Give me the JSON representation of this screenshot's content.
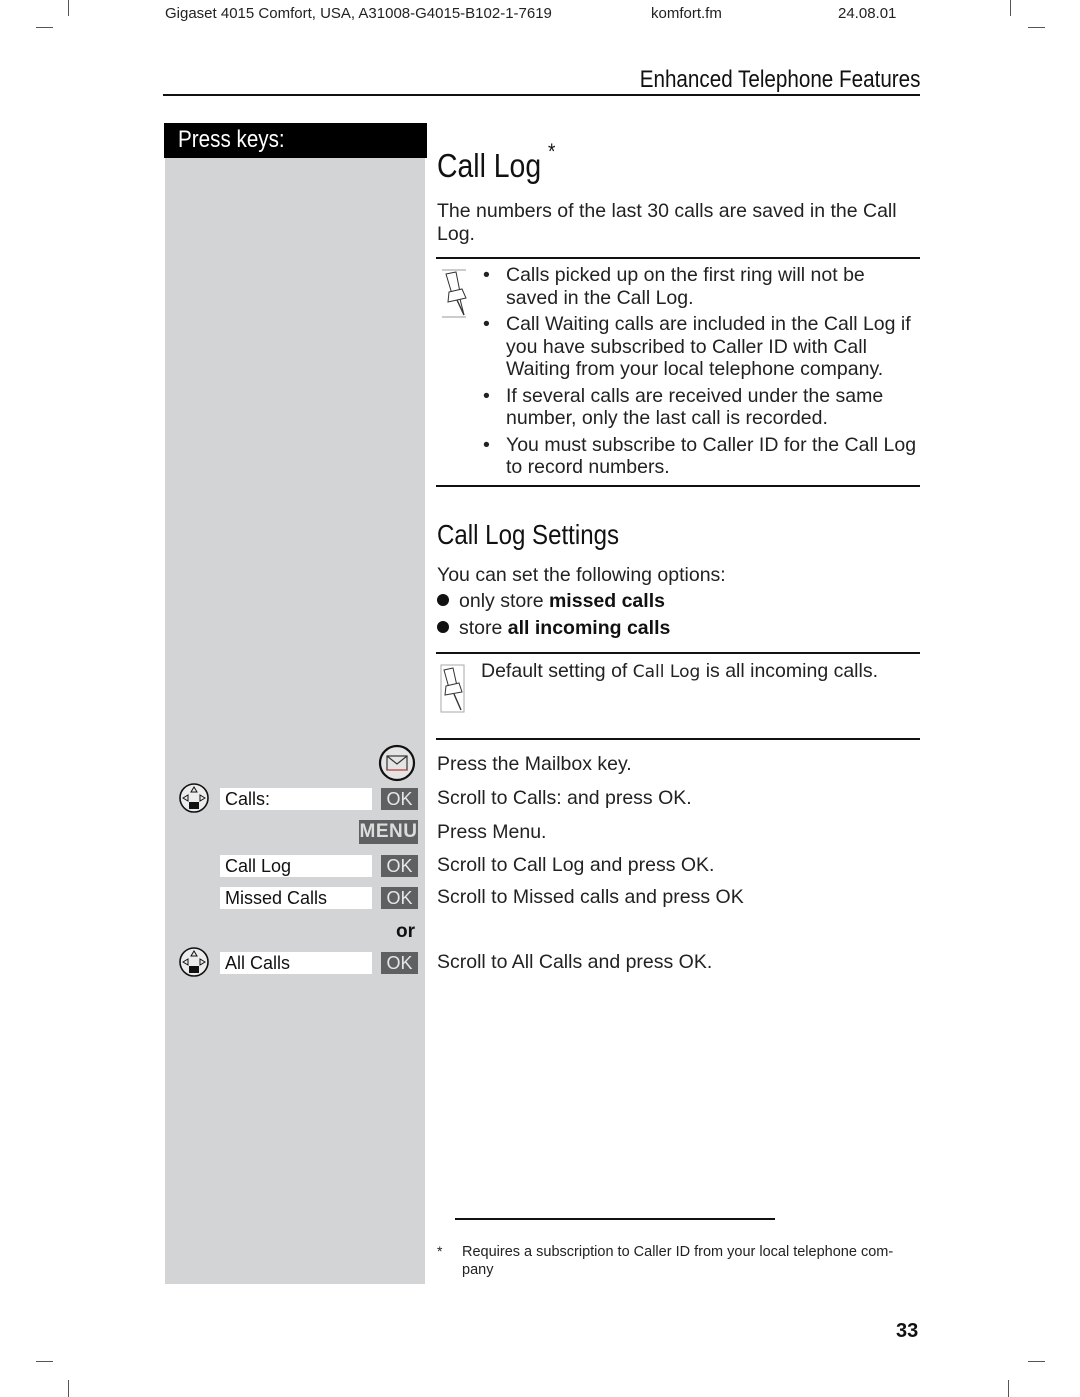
{
  "header": {
    "doc_id": "Gigaset 4015 Comfort, USA, A31008-G4015-B102-1-7619",
    "file": "komfort.fm",
    "date": "24.08.01"
  },
  "section_title": "Enhanced Telephone Features",
  "sidebar": {
    "title": "Press keys:",
    "keys": [
      {
        "icon": "mailbox-key-icon",
        "display": "",
        "button": ""
      },
      {
        "icon": "navigation-key-icon",
        "display": "Calls:",
        "button": "OK"
      },
      {
        "icon": "",
        "display": "",
        "button": "MENU"
      },
      {
        "icon": "",
        "display": "Call Log",
        "button": "OK"
      },
      {
        "icon": "",
        "display": "Missed Calls",
        "button": "OK"
      },
      {
        "icon": "",
        "display": "",
        "button": "",
        "connector": "or"
      },
      {
        "icon": "navigation-key-icon",
        "display": "All Calls",
        "button": "OK"
      }
    ]
  },
  "main": {
    "title": "Call Log",
    "title_marker": "*",
    "intro": "The numbers of the last 30 calls are saved in the Call Log.",
    "notes": {
      "icon": "pushpin-note-icon",
      "items": [
        "Calls picked up on the first ring will not be saved in the Call Log.",
        "Call Waiting calls are included in the Call Log if you have subscribed to Caller ID with Call Waiting from your local telephone company.",
        "If several calls are received under the same number, only the last call is recorded.",
        "You must subscribe to Caller ID for the Call Log to record numbers."
      ]
    },
    "settings": {
      "title": "Call Log Settings",
      "intro": "You can set the following options:",
      "options": [
        {
          "prefix": "only store",
          "bold": "missed calls"
        },
        {
          "prefix": "store",
          "bold": "all incoming calls"
        }
      ],
      "default_note": {
        "icon": "pushpin-note-icon",
        "prefix": "Default setting of",
        "term": "Call Log",
        "suffix": "is all incoming calls."
      }
    },
    "steps": [
      "Press the Mailbox key.",
      "Scroll to Calls: and press OK.",
      "Press Menu.",
      "Scroll to Call Log and press OK.",
      "Scroll to Missed calls and press OK",
      "Scroll to All Calls and press OK."
    ]
  },
  "footnote": {
    "marker": "*",
    "text": "Requires a subscription to Caller ID from your local telephone com-pany"
  },
  "page_number": "33"
}
